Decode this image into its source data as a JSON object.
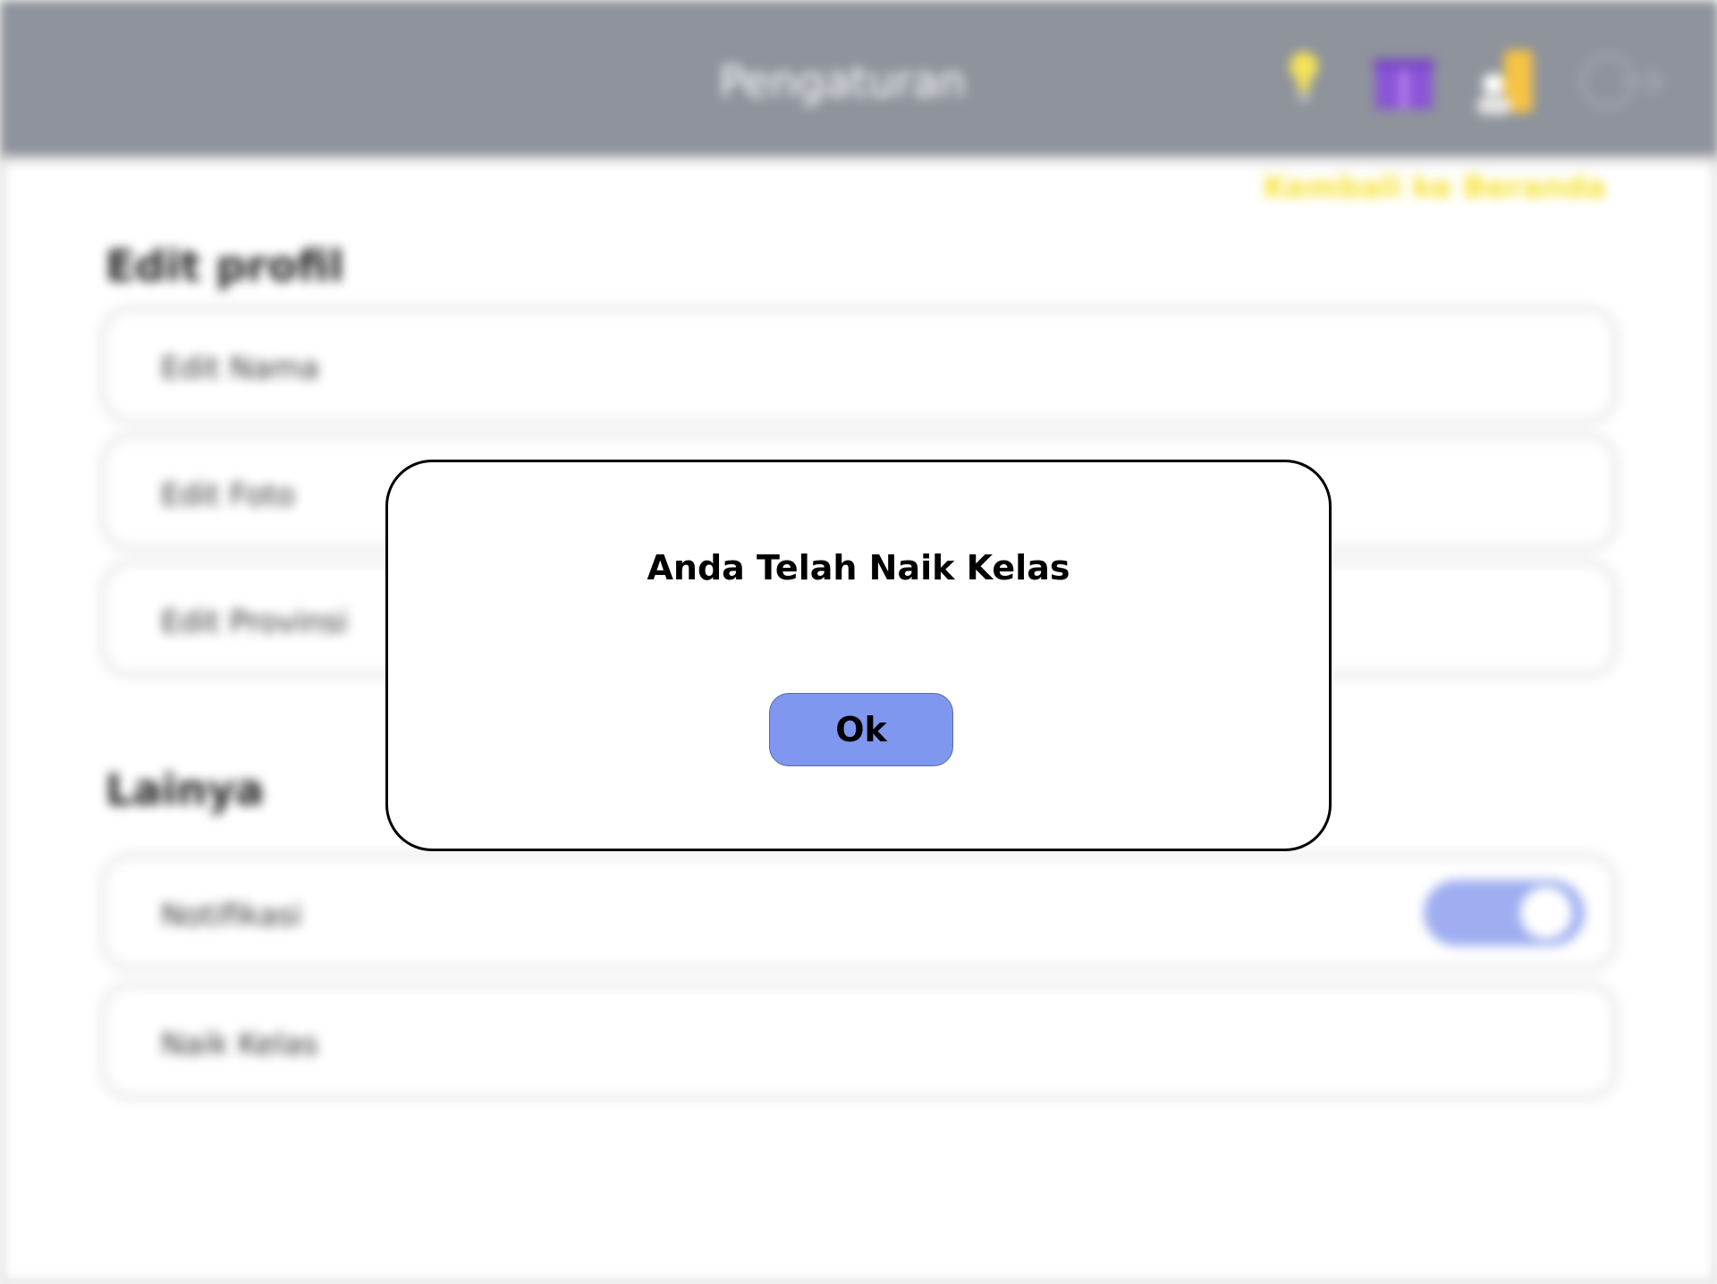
{
  "header": {
    "title": "Pengaturan",
    "icons": [
      "lightbulb-icon",
      "gift-icon",
      "user-icon",
      "logout-icon"
    ]
  },
  "top_link": "Kembali ke Beranda",
  "profile_section": {
    "title": "Edit profil",
    "items": [
      {
        "label": "Edit Nama"
      },
      {
        "label": "Edit Foto"
      },
      {
        "label": "Edit Provinsi"
      }
    ]
  },
  "other_section": {
    "title": "Lainya",
    "items": [
      {
        "label": "Notifikasi",
        "toggle_on": true
      },
      {
        "label": "Naik Kelas"
      }
    ]
  },
  "dialog": {
    "message": "Anda Telah Naik Kelas",
    "ok_label": "Ok"
  },
  "colors": {
    "header_bg": "#8e939c",
    "accent_blue": "#7f97ef",
    "link_yellow": "#f6e233"
  }
}
